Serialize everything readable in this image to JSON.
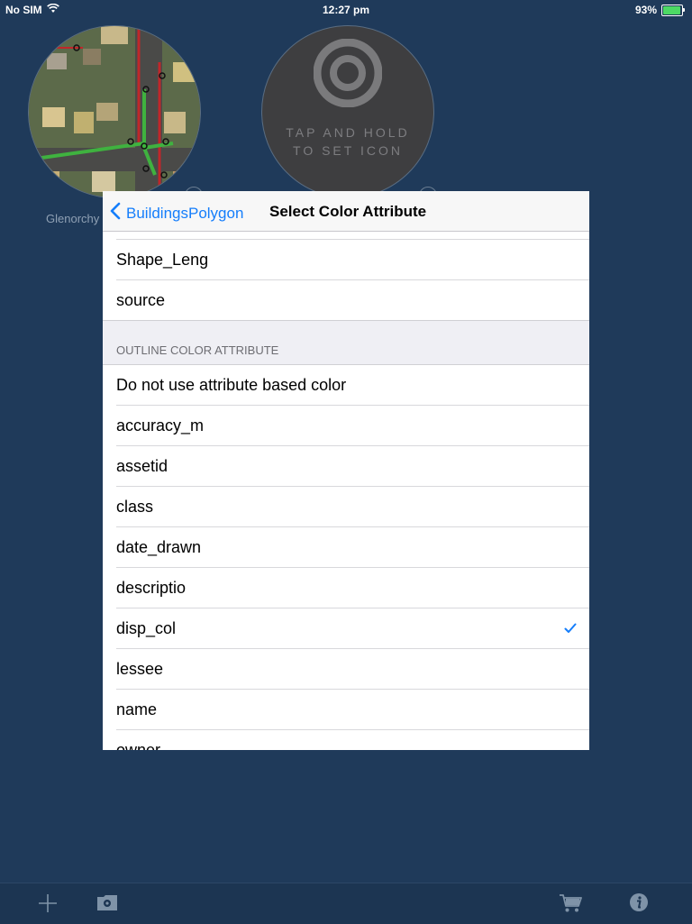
{
  "status_bar": {
    "carrier": "No SIM",
    "time": "12:27 pm",
    "battery_percent": "93%",
    "battery_level": 0.93,
    "wifi_icon": "wifi-icon"
  },
  "background": {
    "tile_label": "Glenorchy",
    "placeholder_line1": "TAP AND HOLD",
    "placeholder_line2": "TO SET ICON",
    "target_icon": "target-icon"
  },
  "popover": {
    "back_label": "BuildingsPolygon",
    "title": "Select Color Attribute",
    "top_rows": [
      "Shape_Leng",
      "source"
    ],
    "section_header": "OUTLINE COLOR ATTRIBUTE",
    "rows": [
      "Do not use attribute based color",
      "accuracy_m",
      "assetid",
      "class",
      "date_drawn",
      "descriptio",
      "disp_col",
      "lessee",
      "name",
      "owner"
    ],
    "selected_row": "disp_col",
    "accent_color": "#157efb"
  },
  "toolbar": {
    "icons": [
      "add-icon",
      "gear-folder-icon",
      "cart-icon",
      "info-icon"
    ]
  }
}
